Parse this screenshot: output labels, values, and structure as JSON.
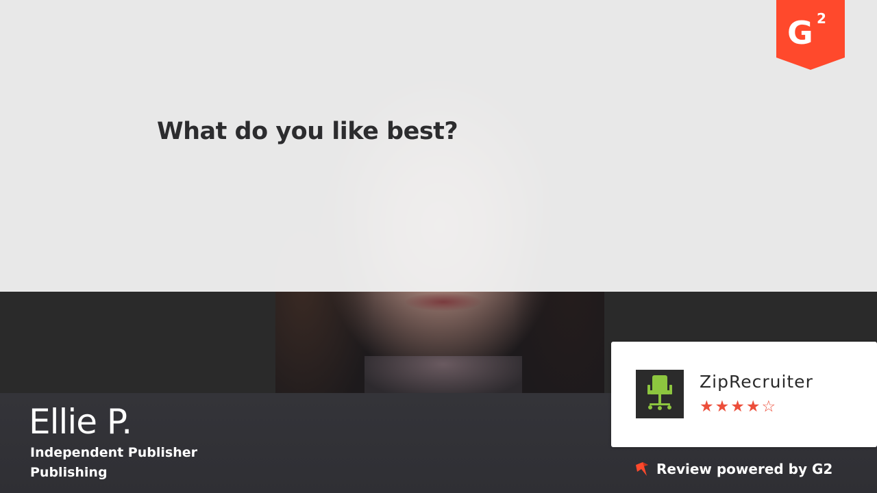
{
  "video": {
    "question": "What do you like best?"
  },
  "reviewer": {
    "name": "Ellie P.",
    "title": "Independent Publisher",
    "industry": "Publishing"
  },
  "product": {
    "name": "ZipRecruiter",
    "logo_icon": "office-chair-icon",
    "rating": 4,
    "rating_max": 5,
    "star_filled": "★",
    "star_empty": "☆"
  },
  "footer": {
    "powered_by": "Review powered by G2",
    "powered_icon": "g2-mark-icon"
  },
  "badge": {
    "icon": "g2-badge-icon",
    "letter": "G",
    "superscript": "2"
  },
  "colors": {
    "g2_red": "#ff492c",
    "star_red": "#ec4e3a",
    "ziprecruiter_green": "#8dc63f",
    "bar_dark": "#333338",
    "overlay_light": "#f0f0f0"
  }
}
